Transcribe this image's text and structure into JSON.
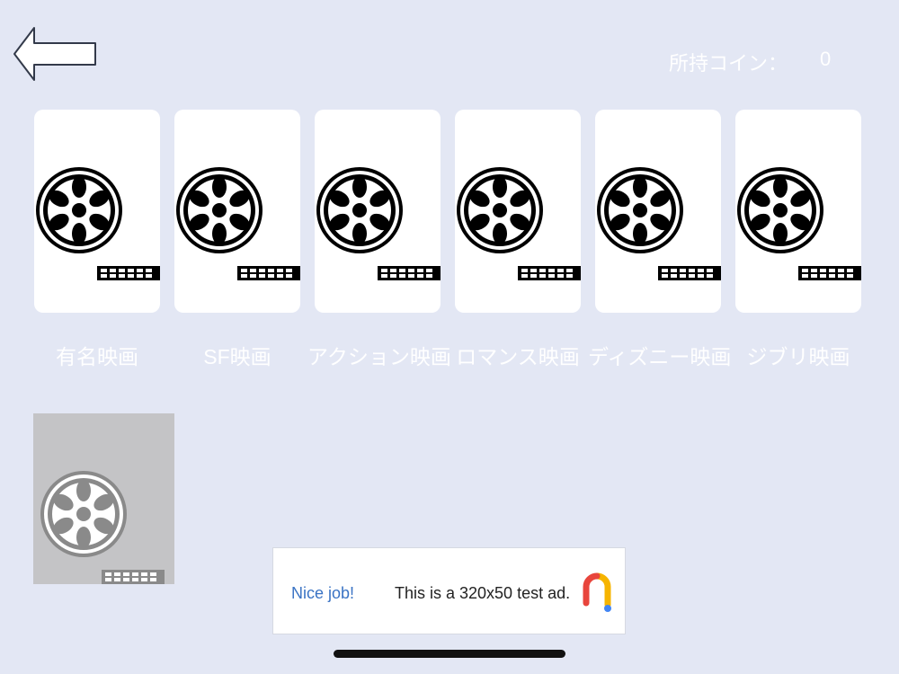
{
  "header": {
    "back_icon": "left-arrow-icon",
    "coin_label": "所持コイン：",
    "coin_value": "0"
  },
  "categories": [
    {
      "label": "有名映画",
      "icon": "film-reel-icon"
    },
    {
      "label": "SF映画",
      "icon": "film-reel-icon"
    },
    {
      "label": "アクション映画",
      "icon": "film-reel-icon"
    },
    {
      "label": "ロマンス映画",
      "icon": "film-reel-icon"
    },
    {
      "label": "ディズニー映画",
      "icon": "film-reel-icon"
    },
    {
      "label": "ジブリ映画",
      "icon": "film-reel-icon"
    }
  ],
  "locked_category": {
    "icon": "film-reel-icon",
    "state": "locked"
  },
  "ad": {
    "nice_label": "Nice job!",
    "text": "This is a 320x50 test ad.",
    "logo_icon": "google-ads-logo-icon"
  },
  "colors": {
    "background": "#e3e7f4",
    "card": "#ffffff",
    "label": "#ffffff",
    "ad_link": "#3a73c4"
  }
}
